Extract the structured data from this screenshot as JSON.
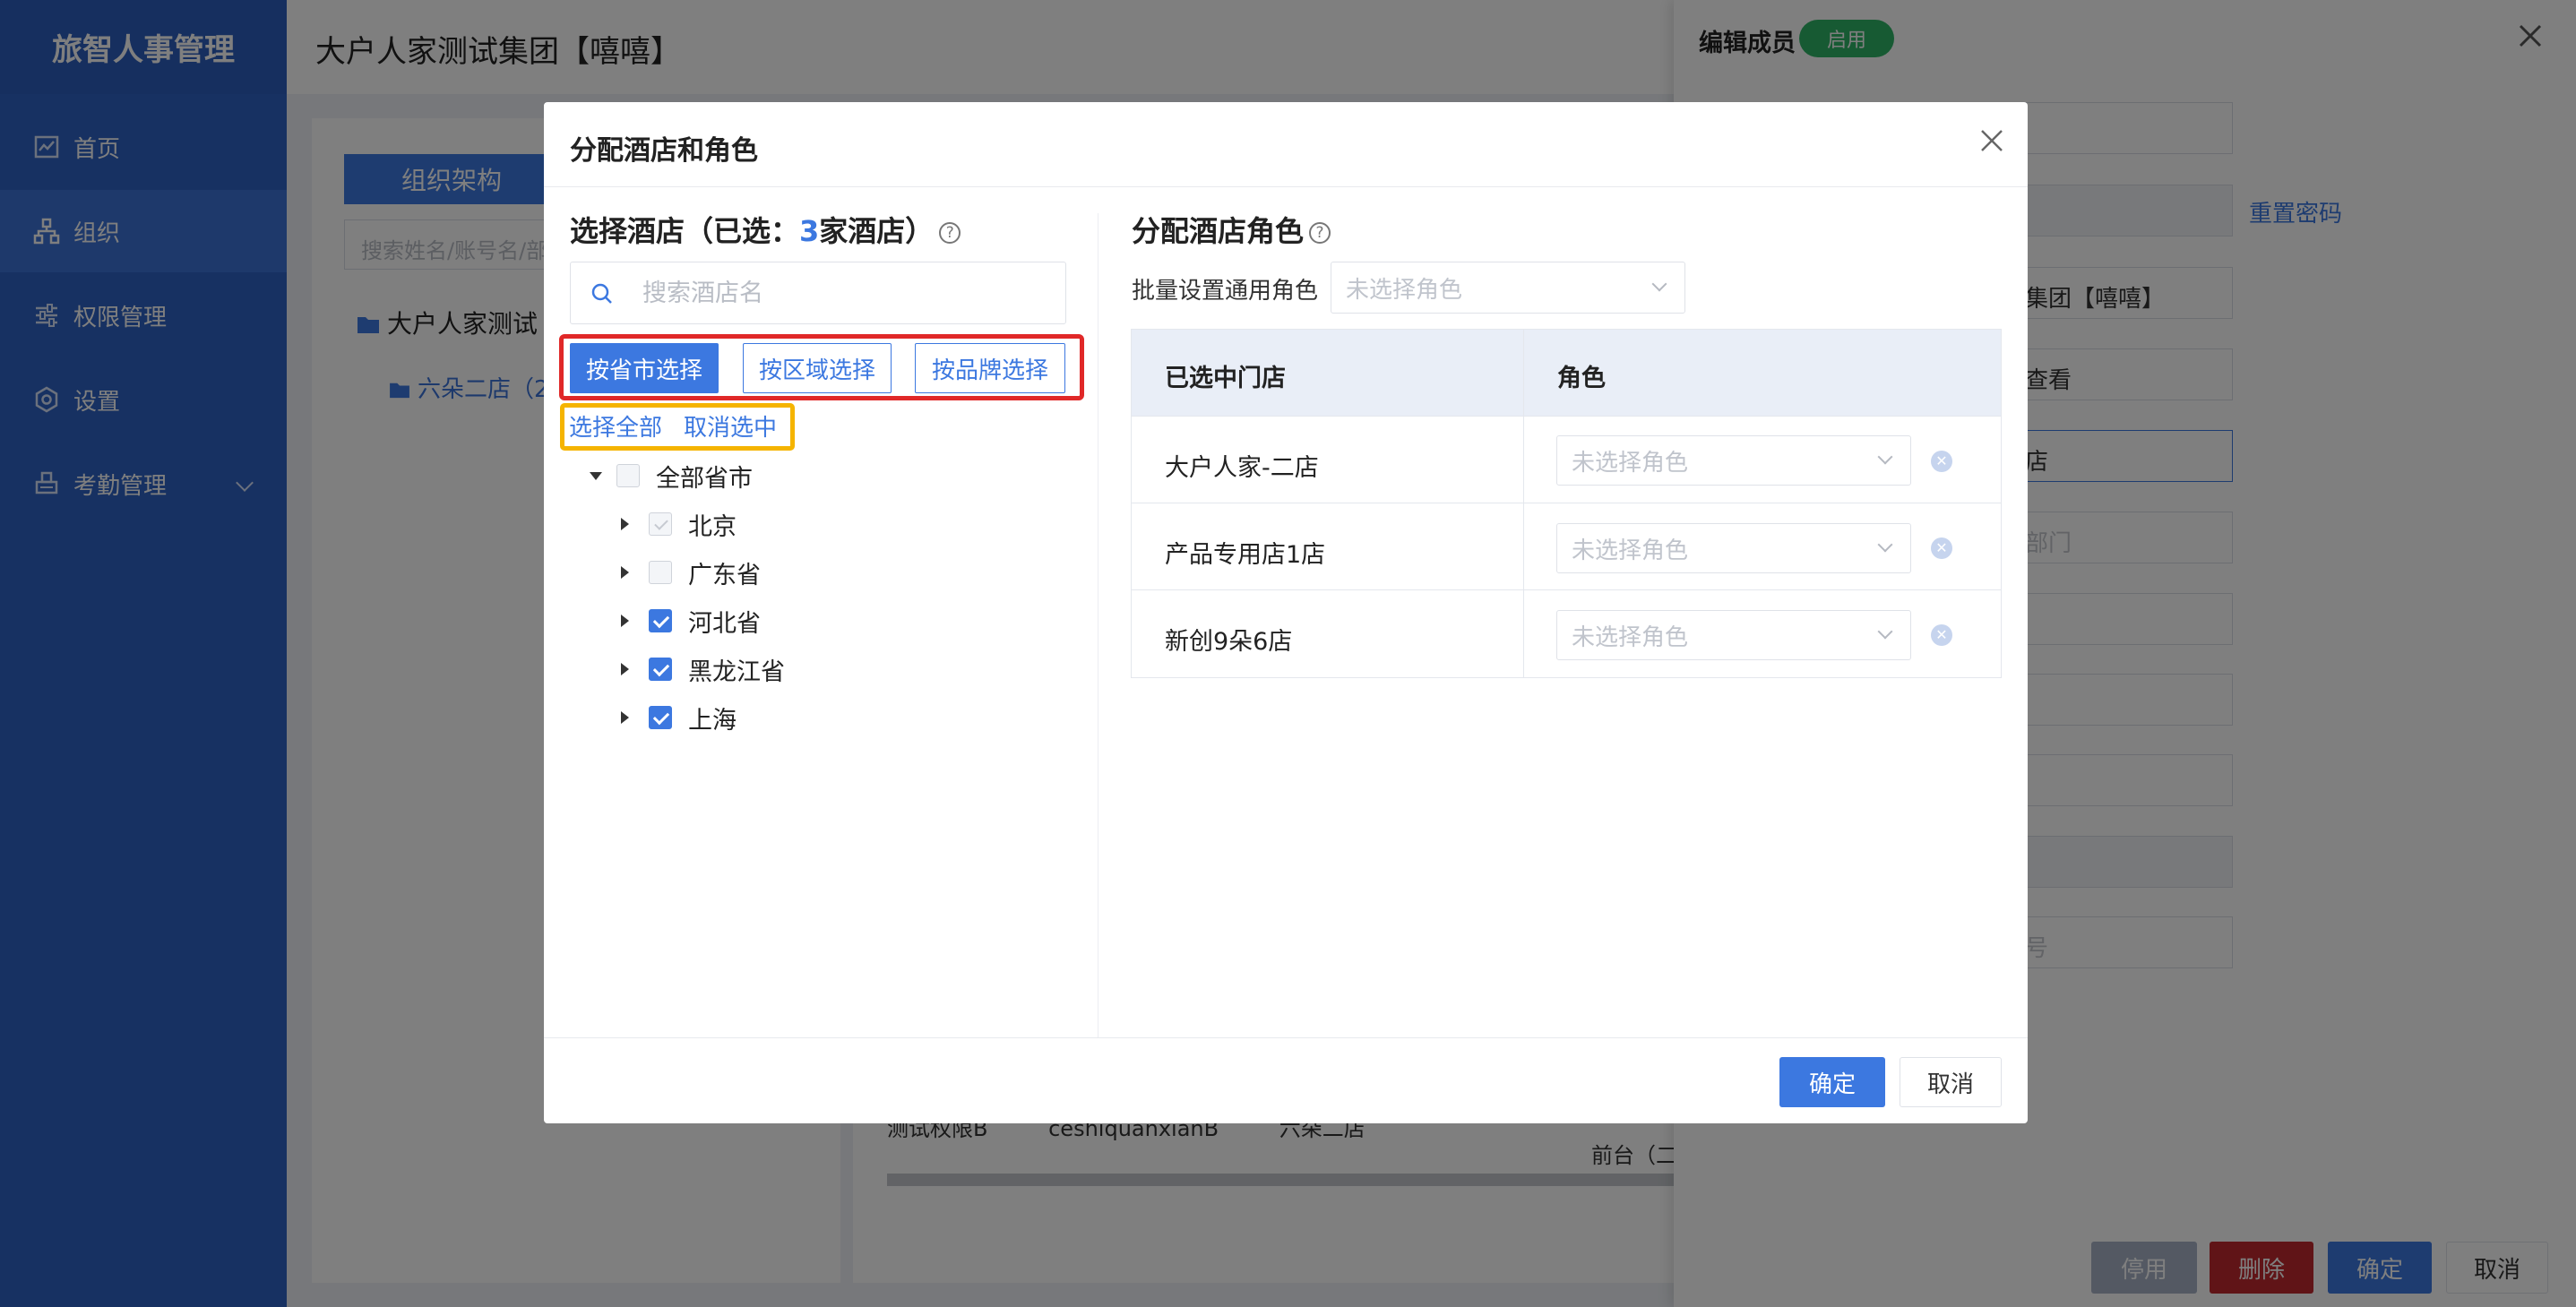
{
  "app": {
    "name": "旅智人事管理"
  },
  "sidebar": {
    "items": [
      {
        "label": "首页",
        "icon": "chart-icon"
      },
      {
        "label": "组织",
        "icon": "org-icon",
        "active": true
      },
      {
        "label": "权限管理",
        "icon": "sliders-icon"
      },
      {
        "label": "设置",
        "icon": "gear-icon"
      },
      {
        "label": "考勤管理",
        "icon": "attendance-icon",
        "expandable": true
      }
    ]
  },
  "header": {
    "company": "大户人家测试集团【嘻嘻】"
  },
  "background": {
    "org_tab": "组织架构",
    "search_placeholder": "搜索姓名/账号名/部门",
    "tree_root": "大户人家测试",
    "tree_child": "六朵二店（2",
    "row": [
      "测试权限B",
      "ceshiquanxianB",
      "六朵二店"
    ],
    "row_role": "前台（二"
  },
  "drawer": {
    "title": "编辑成员",
    "badge": "启用",
    "reset_password": "重置密码",
    "fields": [
      "集团【嘻嘻】",
      "查看",
      "店",
      "部门",
      "号"
    ],
    "buttons": {
      "disable": "停用",
      "delete": "删除",
      "confirm": "确定",
      "cancel": "取消"
    }
  },
  "modal": {
    "title": "分配酒店和角色",
    "left": {
      "title_prefix": "选择酒店（已选：",
      "count": "3",
      "title_suffix": "家酒店）",
      "search_placeholder": "搜索酒店名",
      "modes": [
        "按省市选择",
        "按区域选择",
        "按品牌选择"
      ],
      "select_all": "选择全部",
      "deselect": "取消选中",
      "tree": {
        "root": "全部省市",
        "items": [
          {
            "label": "北京",
            "checked": false,
            "disabled": true
          },
          {
            "label": "广东省",
            "checked": false,
            "disabled": false
          },
          {
            "label": "河北省",
            "checked": true,
            "disabled": false
          },
          {
            "label": "黑龙江省",
            "checked": true,
            "disabled": false
          },
          {
            "label": "上海",
            "checked": true,
            "disabled": false
          }
        ]
      }
    },
    "right": {
      "title": "分配酒店角色",
      "batch_label": "批量设置通用角色",
      "batch_placeholder": "未选择角色",
      "columns": [
        "已选中门店",
        "角色"
      ],
      "rows": [
        {
          "store": "大户人家-二店",
          "role_placeholder": "未选择角色"
        },
        {
          "store": "产品专用店1店",
          "role_placeholder": "未选择角色"
        },
        {
          "store": "新创9朵6店",
          "role_placeholder": "未选择角色"
        }
      ]
    },
    "footer": {
      "ok": "确定",
      "cancel": "取消"
    }
  },
  "colors": {
    "primary": "#3c78e0",
    "sidebar": "#2f63c5",
    "highlight_red": "#e02828",
    "highlight_yellow": "#f5b400",
    "success": "#2fb467"
  }
}
